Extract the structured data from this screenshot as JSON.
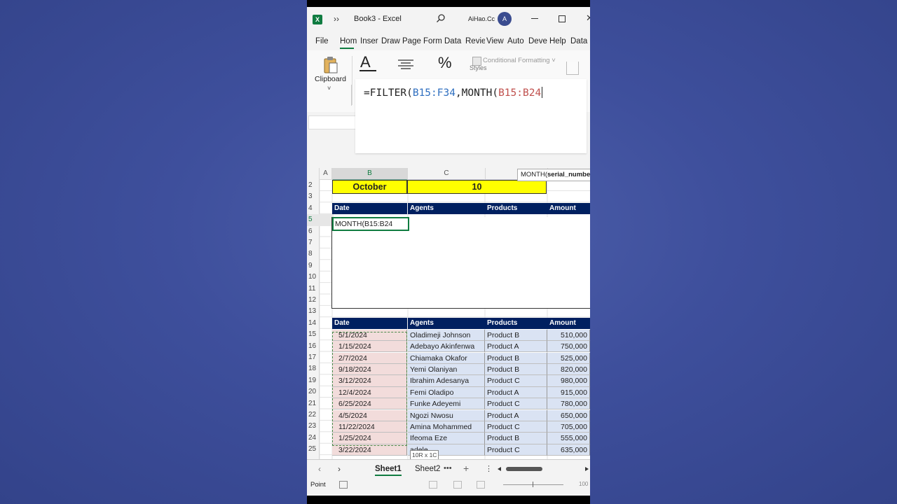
{
  "window": {
    "title": "Book3  -  Excel",
    "user": "AiHao.Cc",
    "avatar_initial": "A",
    "more": "››"
  },
  "tabs": [
    "File",
    "Hom",
    "Inser",
    "Draw",
    "Page",
    "Form",
    "Data",
    "Revie",
    "View",
    "Auto",
    "Deve",
    "Help",
    "Data"
  ],
  "ribbon": {
    "clipboard_label": "Clipboard",
    "conditional_formatting": "Conditional Formatting ˅",
    "styles": "Styles"
  },
  "formula": {
    "part1": "=FILTER(",
    "part2": "B15:F34",
    "part3": ",MONTH(",
    "part4": "B15:B24"
  },
  "tooltip": {
    "fn": "MONTH(",
    "arg": "serial_numbe"
  },
  "columns": [
    "A",
    "B",
    "C"
  ],
  "cells": {
    "b2": "October",
    "c2": "10",
    "b5": "MONTH(B15:B24"
  },
  "rows": [
    "2",
    "3",
    "4",
    "5",
    "6",
    "7",
    "8",
    "9",
    "10",
    "11",
    "12",
    "13",
    "14",
    "15",
    "16",
    "17",
    "18",
    "19",
    "20",
    "21",
    "22",
    "23",
    "24",
    "25"
  ],
  "output_headers": [
    "Date",
    "Agents",
    "Products",
    "Amount"
  ],
  "source_headers": [
    "Date",
    "Agents",
    "Products",
    "Amount"
  ],
  "source_rows": [
    {
      "date": "5/1/2024",
      "agent": "Oladimeji Johnson",
      "product": "Product B",
      "amount": "510,000"
    },
    {
      "date": "1/15/2024",
      "agent": "Adebayo Akinfenwa",
      "product": "Product A",
      "amount": "750,000"
    },
    {
      "date": "2/7/2024",
      "agent": "Chiamaka Okafor",
      "product": "Product B",
      "amount": "525,000"
    },
    {
      "date": "9/18/2024",
      "agent": "Yemi Olaniyan",
      "product": "Product B",
      "amount": "820,000"
    },
    {
      "date": "3/12/2024",
      "agent": "Ibrahim Adesanya",
      "product": "Product C",
      "amount": "980,000"
    },
    {
      "date": "12/4/2024",
      "agent": "Femi Oladipo",
      "product": "Product A",
      "amount": "915,000"
    },
    {
      "date": "6/25/2024",
      "agent": "Funke Adeyemi",
      "product": "Product C",
      "amount": "780,000"
    },
    {
      "date": "4/5/2024",
      "agent": "Ngozi Nwosu",
      "product": "Product A",
      "amount": "650,000"
    },
    {
      "date": "11/22/2024",
      "agent": "Amina Mohammed",
      "product": "Product C",
      "amount": "705,000"
    },
    {
      "date": "1/25/2024",
      "agent": "Ifeoma Eze",
      "product": "Product B",
      "amount": "555,000"
    },
    {
      "date": "3/22/2024",
      "agent": "   adele",
      "product": "Product C",
      "amount": "635,000"
    }
  ],
  "size_tip": "10R x 1C",
  "sheets": [
    "Sheet1",
    "Sheet2"
  ],
  "status": {
    "mode": "Point",
    "zoom": "100"
  }
}
